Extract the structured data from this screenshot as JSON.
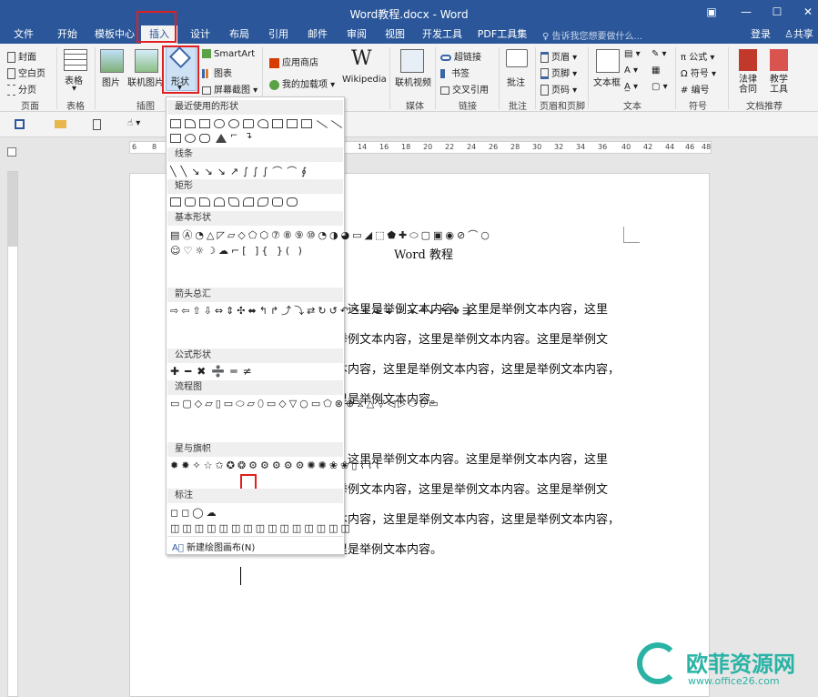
{
  "window": {
    "title": "Word教程.docx - Word",
    "login": "登录",
    "share": "共享",
    "tell_me": "♀ 告诉我您想要做什么..."
  },
  "tabs": [
    "文件",
    "开始",
    "模板中心",
    "插入",
    "设计",
    "布局",
    "引用",
    "邮件",
    "审阅",
    "视图",
    "开发工具",
    "PDF工具集"
  ],
  "active_tab": "插入",
  "ribbon": {
    "groups": {
      "pages": {
        "label": "页面",
        "items": [
          "封面",
          "空白页",
          "分页"
        ]
      },
      "tables": {
        "label": "表格",
        "items": [
          "表格"
        ]
      },
      "illustrations": {
        "label": "插图",
        "items": [
          "图片",
          "联机图片",
          "形状",
          "SmartArt",
          "图表",
          "屏幕截图"
        ]
      },
      "addins": {
        "label": "",
        "items": [
          "应用商店",
          "我的加载项",
          "Wikipedia"
        ]
      },
      "media": {
        "label": "媒体",
        "items": [
          "联机视频"
        ]
      },
      "links": {
        "label": "链接",
        "items": [
          "超链接",
          "书签",
          "交叉引用"
        ]
      },
      "comments": {
        "label": "批注",
        "items": [
          "批注"
        ]
      },
      "header_footer": {
        "label": "页眉和页脚",
        "items": [
          "页眉",
          "页脚",
          "页码"
        ]
      },
      "text": {
        "label": "文本",
        "items": [
          "文本框"
        ]
      },
      "symbols": {
        "label": "符号",
        "items": [
          "公式",
          "符号",
          "编号"
        ]
      },
      "docrec": {
        "label": "文档推荐",
        "items": [
          "法律合同",
          "教学工具"
        ]
      }
    }
  },
  "ruler_numbers": [
    "6",
    "8",
    "14",
    "16",
    "18",
    "20",
    "22",
    "24",
    "26",
    "28",
    "30",
    "32",
    "34",
    "36",
    "40",
    "42",
    "44",
    "46",
    "48"
  ],
  "document": {
    "title": "Word 教程",
    "lines": [
      "，这里是举例文本内容。这里是举例文本内容，这里",
      "举例文本内容，这里是举例文本内容。这里是举例文",
      "本内容，这里是举例文本内容，这里是举例文本内容，",
      "里是举例文本内容。",
      "，这里是举例文本内容。这里是举例文本内容，这里",
      "举例文本内容，这里是举例文本内容。这里是举例文",
      "本内容，这里是举例文本内容，这里是举例文本内容，",
      "里是举例文本内容。"
    ]
  },
  "shapes_menu": {
    "sections": [
      "最近使用的形状",
      "线条",
      "矩形",
      "基本形状",
      "箭头总汇",
      "公式形状",
      "流程图",
      "星与旗帜",
      "标注"
    ],
    "footer": "新建绘图画布(N)"
  },
  "watermark": {
    "brand": "欧菲资源网",
    "url": "www.office26.com"
  },
  "colors": {
    "accent": "#2b579a",
    "highlight": "#e02020"
  }
}
